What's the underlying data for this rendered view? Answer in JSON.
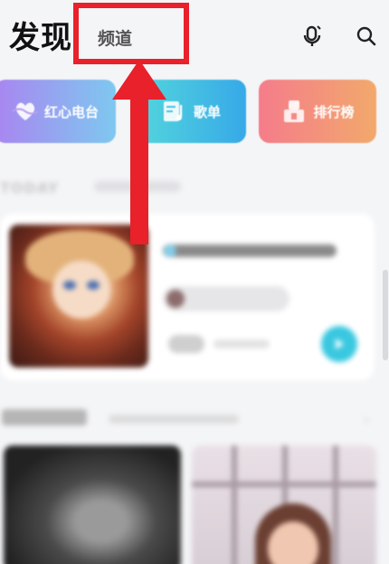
{
  "header": {
    "title": "发现",
    "tab_label": "频道",
    "icons": {
      "voice": "voice-mic-icon",
      "search": "search-icon"
    },
    "highlight_color": "#e8212b"
  },
  "categories": [
    {
      "label": "红心电台",
      "icon": "heart-radio-icon",
      "gradient": [
        "#a985f0",
        "#7ec8f0"
      ]
    },
    {
      "label": "歌单",
      "icon": "playlist-music-icon",
      "gradient": [
        "#53d6dd",
        "#37a9e8"
      ]
    },
    {
      "label": "排行榜",
      "icon": "ranking-trophy-icon",
      "gradient": [
        "#f57c8b",
        "#f2a96c"
      ]
    }
  ],
  "today": {
    "label": "TODAY"
  },
  "accent": "#39c8e0"
}
